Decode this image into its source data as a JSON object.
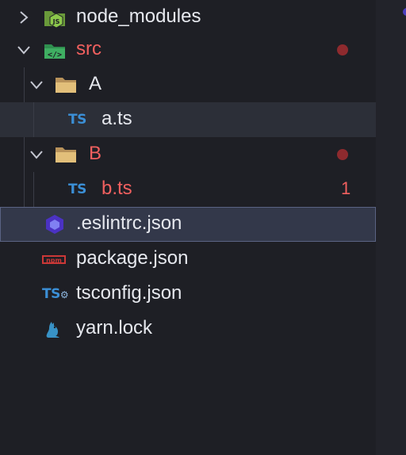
{
  "explorer": {
    "items": [
      {
        "label": "node_modules",
        "kind": "folder",
        "expanded": false,
        "icon": "nodejs-folder-icon"
      },
      {
        "label": "src",
        "kind": "folder",
        "expanded": true,
        "icon": "src-folder-icon",
        "modified": true
      },
      {
        "label": "A",
        "kind": "folder",
        "expanded": true,
        "icon": "folder-open-icon"
      },
      {
        "label": "a.ts",
        "kind": "file",
        "icon": "typescript-icon",
        "selected": true
      },
      {
        "label": "B",
        "kind": "folder",
        "expanded": true,
        "icon": "folder-open-icon",
        "modified": true
      },
      {
        "label": "b.ts",
        "kind": "file",
        "icon": "typescript-icon",
        "modified": true,
        "problems": "1"
      },
      {
        "label": ".eslintrc.json",
        "kind": "file",
        "icon": "eslint-icon",
        "focused": true
      },
      {
        "label": "package.json",
        "kind": "file",
        "icon": "npm-icon"
      },
      {
        "label": "tsconfig.json",
        "kind": "file",
        "icon": "tsconfig-icon"
      },
      {
        "label": "yarn.lock",
        "kind": "file",
        "icon": "yarn-icon"
      }
    ]
  },
  "icons": {
    "ts_text": "TS",
    "npm_text": "npm"
  },
  "colors": {
    "modified": "#f1605f",
    "modified_dot": "#8e2a2e",
    "typescript": "#3b8fd6",
    "folder": "#d9b26a",
    "node_green": "#8cc84b",
    "eslint": "#4b32c3"
  }
}
